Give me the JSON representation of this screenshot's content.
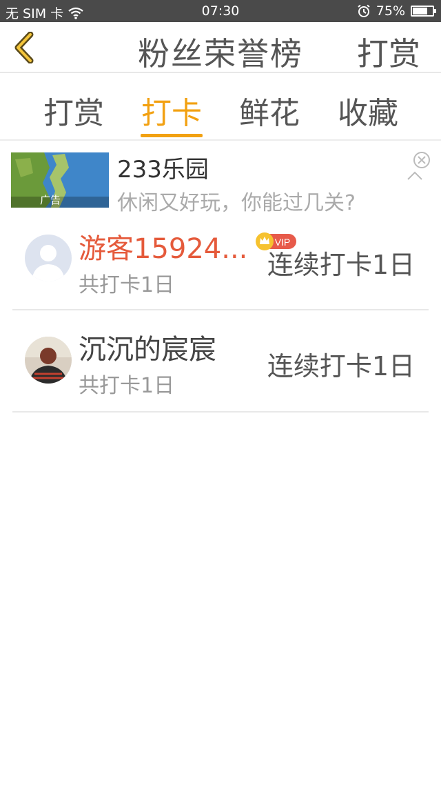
{
  "status_bar": {
    "carrier": "无 SIM 卡",
    "time": "07:30",
    "battery": "75%",
    "battery_level": 0.75
  },
  "nav": {
    "title": "粉丝荣誉榜",
    "action_label": "打赏",
    "back_icon": "chevron-left-icon"
  },
  "tabs": [
    {
      "label": "打赏",
      "active": false
    },
    {
      "label": "打卡",
      "active": true
    },
    {
      "label": "鲜花",
      "active": false
    },
    {
      "label": "收藏",
      "active": false
    }
  ],
  "ad": {
    "title": "233乐园",
    "description": "休闲又好玩，你能过几关?",
    "badge": "广告"
  },
  "entries": [
    {
      "name": "游客15924...",
      "vip": true,
      "vip_label": "VIP",
      "total": "共打卡1日",
      "streak": "连续打卡1日"
    },
    {
      "name": "沉沉的宸宸",
      "vip": false,
      "total": "共打卡1日",
      "streak": "连续打卡1日"
    }
  ],
  "colors": {
    "accent": "#f2a112",
    "vip_name": "#e55a3b",
    "status_bar": "#4a4a4a"
  }
}
